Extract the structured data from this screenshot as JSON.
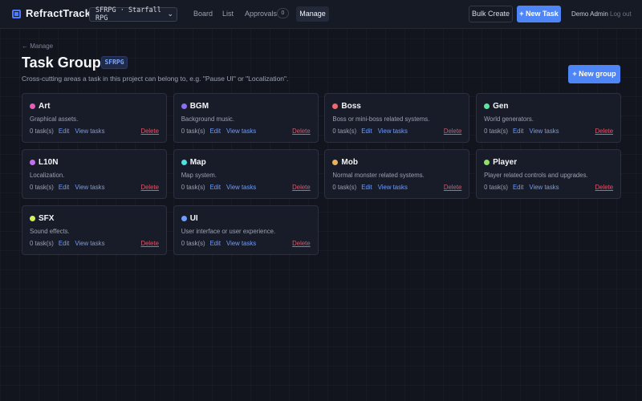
{
  "app": {
    "name": "RefractTrack"
  },
  "header": {
    "project_select": "SFRPG · Starfall RPG",
    "nav": {
      "board": "Board",
      "list": "List",
      "approvals": "Approvals",
      "approvals_count": "0",
      "manage": "Manage"
    },
    "bulk_create": "Bulk Create",
    "new_task": "+ New Task",
    "user": "Demo Admin",
    "logout": "Log out"
  },
  "page": {
    "breadcrumb": "← Manage",
    "title": "Task Groups",
    "project_code": "SFRPG",
    "subtitle": "Cross-cutting areas a task in this project can belong to, e.g. \"Pause UI\" or \"Localization\".",
    "new_group": "+ New group"
  },
  "groups": [
    {
      "name": "Art",
      "description": "Graphical assets.",
      "color": "#e25fb8",
      "count": "0 task(s)",
      "edit": "Edit",
      "view": "View tasks",
      "delete": "Delete"
    },
    {
      "name": "BGM",
      "description": "Background music.",
      "color": "#8c6ef2",
      "count": "0 task(s)",
      "edit": "Edit",
      "view": "View tasks",
      "delete": "Delete"
    },
    {
      "name": "Boss",
      "description": "Boss or mini-boss related systems.",
      "color": "#ef6a6a",
      "count": "0 task(s)",
      "edit": "Edit",
      "view": "View tasks",
      "delete": "Delete"
    },
    {
      "name": "Gen",
      "description": "World generators.",
      "color": "#5fe3a1",
      "count": "0 task(s)",
      "edit": "Edit",
      "view": "View tasks",
      "delete": "Delete"
    },
    {
      "name": "L10N",
      "description": "Localization.",
      "color": "#c56ff0",
      "count": "0 task(s)",
      "edit": "Edit",
      "view": "View tasks",
      "delete": "Delete"
    },
    {
      "name": "Map",
      "description": "Map system.",
      "color": "#4fe0e3",
      "count": "0 task(s)",
      "edit": "Edit",
      "view": "View tasks",
      "delete": "Delete"
    },
    {
      "name": "Mob",
      "description": "Normal monster related systems.",
      "color": "#e8b15c",
      "count": "0 task(s)",
      "edit": "Edit",
      "view": "View tasks",
      "delete": "Delete"
    },
    {
      "name": "Player",
      "description": "Player related controls and upgrades.",
      "color": "#8ee06a",
      "count": "0 task(s)",
      "edit": "Edit",
      "view": "View tasks",
      "delete": "Delete"
    },
    {
      "name": "SFX",
      "description": "Sound effects.",
      "color": "#d4ef5a",
      "count": "0 task(s)",
      "edit": "Edit",
      "view": "View tasks",
      "delete": "Delete"
    },
    {
      "name": "UI",
      "description": "User interface or user experience.",
      "color": "#6e9cff",
      "count": "0 task(s)",
      "edit": "Edit",
      "view": "View tasks",
      "delete": "Delete"
    }
  ]
}
